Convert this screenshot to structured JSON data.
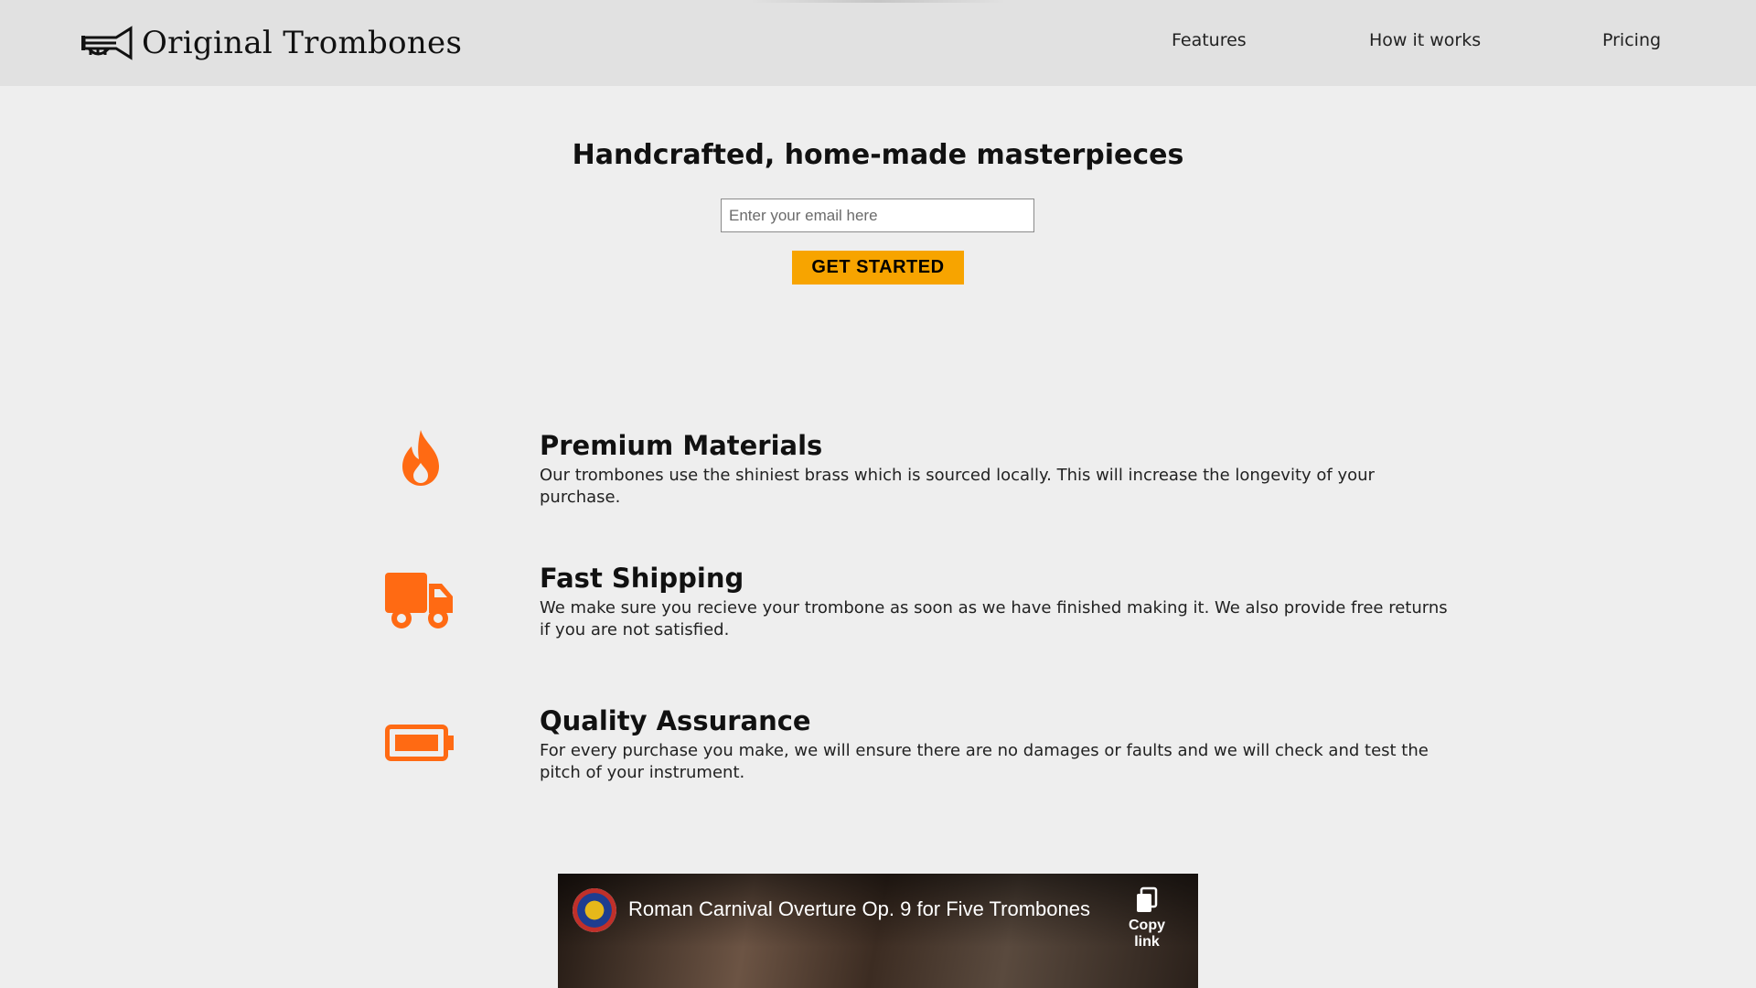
{
  "header": {
    "brand": "Original Trombones",
    "nav": [
      "Features",
      "How it works",
      "Pricing"
    ]
  },
  "hero": {
    "title": "Handcrafted, home-made masterpieces",
    "email_placeholder": "Enter your email here",
    "cta_label": "GET STARTED"
  },
  "features": [
    {
      "icon": "fire-icon",
      "title": "Premium Materials",
      "text": "Our trombones use the shiniest brass which is sourced locally. This will increase the longevity of your purchase."
    },
    {
      "icon": "truck-icon",
      "title": "Fast Shipping",
      "text": "We make sure you recieve your trombone as soon as we have finished making it. We also provide free returns if you are not satisfied."
    },
    {
      "icon": "battery-icon",
      "title": "Quality Assurance",
      "text": "For every purchase you make, we will ensure there are no damages or faults and we will check and test the pitch of your instrument."
    }
  ],
  "video": {
    "title": "Roman Carnival Overture Op. 9 for Five Trombones",
    "copy_label": "Copy link"
  },
  "colors": {
    "accent_orange": "#ff6a13",
    "cta_yellow": "#f7a400",
    "header_bg": "#e1e1e1",
    "page_bg": "#eeeeee"
  }
}
